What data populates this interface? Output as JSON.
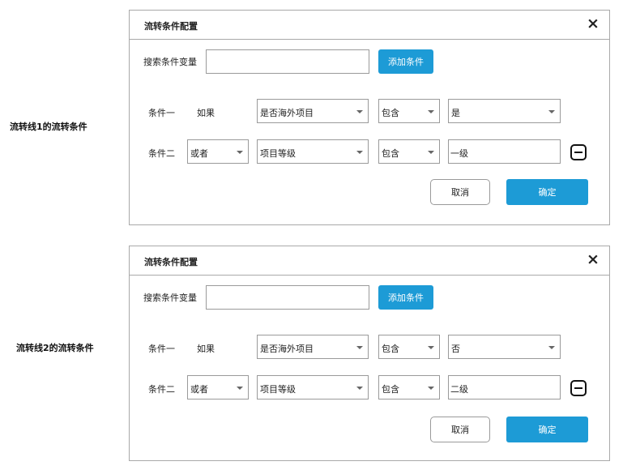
{
  "dialogs": [
    {
      "side_label": "流转线1的流转条件",
      "title": "流转条件配置",
      "close_icon": "×",
      "search_label": "搜索条件变量",
      "search_value": "",
      "add_button": "添加条件",
      "conditions": [
        {
          "label": "条件一",
          "connector": "如果",
          "field": "是否海外项目",
          "operator": "包含",
          "value": "是"
        },
        {
          "label": "条件二",
          "connector": "或者",
          "field": "项目等级",
          "operator": "包含",
          "value": "一级"
        }
      ],
      "cancel_button": "取消",
      "confirm_button": "确定"
    },
    {
      "side_label": "流转线2的流转条件",
      "title": "流转条件配置",
      "close_icon": "×",
      "search_label": "搜索条件变量",
      "search_value": "",
      "add_button": "添加条件",
      "conditions": [
        {
          "label": "条件一",
          "connector": "如果",
          "field": "是否海外项目",
          "operator": "包含",
          "value": "否"
        },
        {
          "label": "条件二",
          "connector": "或者",
          "field": "项目等级",
          "operator": "包含",
          "value": "二级"
        }
      ],
      "cancel_button": "取消",
      "confirm_button": "确定"
    }
  ]
}
